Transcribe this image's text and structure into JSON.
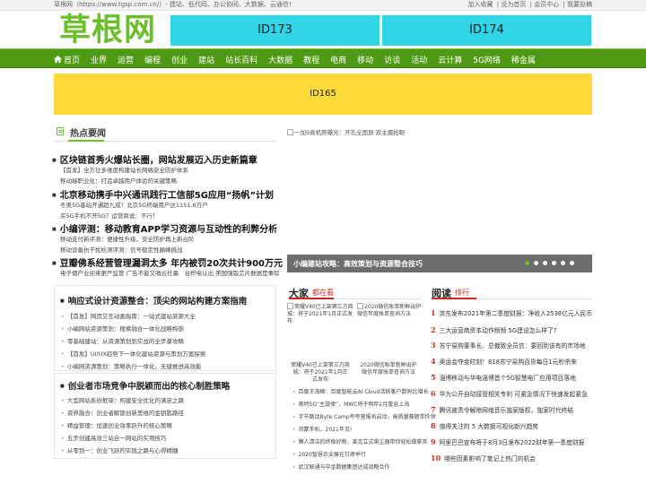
{
  "topbar": {
    "site_intro": "草根网（https://www.tgsp.com.cn/）- 建站、低代码、办公协同、大数据、云通信!",
    "links": [
      "加入收藏",
      "设为首页",
      "会员中心",
      "我要投稿"
    ],
    "separator": "|"
  },
  "logo": {
    "text": "草根网"
  },
  "ads": {
    "top_left": "ID173",
    "top_right": "ID174",
    "banner": "ID165"
  },
  "nav": {
    "home_icon": "home-icon",
    "items": [
      "首页",
      "业界",
      "运营",
      "编程",
      "创业",
      "建站",
      "站长百科",
      "大数据",
      "教程",
      "电商",
      "移动",
      "访谈",
      "活动",
      "云计算",
      "5G网络",
      "稀金属"
    ]
  },
  "hot": {
    "title": "热点要闻",
    "headlines": [
      {
        "title": "区块链首秀火爆站长圈，网站发展迈入历史新篇章",
        "subs": [
          "【首发】全方位多维度构建站长网络安全防护体系",
          "移动端职业化：打造卓越用户体验的关键策略"
        ]
      },
      {
        "title": "北京移动携手中兴通讯践行工信部5G应用“扬帆”计划",
        "subs": [
          "冬奥5G基站开通超九成！北京5G终端用户达1151.6万户",
          "买5G手机不开5G？运营商说：不行！"
        ]
      },
      {
        "title": "小编评测：移动教育APP学习资源与互动性的利弊分析",
        "subs": [
          "移动支付新评测：便捷性升级，安全防护再上新台阶",
          "移动设备抗干扰检测评测：信号稳定性巅峰挑战"
        ]
      },
      {
        "title": "豆瓣佛系经营管理漏洞太多 年内被罚20次共计900万元",
        "subs": [
          "电子烟产业迎来更严监管 广告不能又哨云社裏　台积电认出 美国强取芯片数据是事赊"
        ]
      }
    ]
  },
  "box1": {
    "title": "响应式设计资源整合：顶尖的网站构建方案指南",
    "items": [
      "【首发】网页交互动画指南：一站式建站资源大全",
      "小编网站资源策划：搜索融合一体化战略构想",
      "零基础建站：从资源策划到实战的全步骤攻略",
      "【首发】UI/UX趋势下一体化建站资源与策划方案探索",
      "小编网资源策划：策略执行一体化，无缝推进高效能"
    ]
  },
  "box2": {
    "title": "创业者市场竞争中脱颖而出的核心制胜策略",
    "items": [
      "大型网站系统框架：构建安全优化的满足之路",
      "资界融合：创业者解锁创新思维的金钥匙路径",
      "精益管理：加速创业效率跃升的核心策略",
      "五步创建高效三站合一网站的实用技巧",
      "从零到一：创业飞跃的实践之路与心得精髓"
    ]
  },
  "slider": {
    "img_alt": "一加9真机照曝光：开孔全面屏 双主摄抢眼",
    "caption": "小编建站攻略：高效策划与资源整合技巧",
    "dots": 6,
    "active_dot": 0
  },
  "recommend": {
    "label_cn": "大家",
    "label_em": "都在看",
    "thumbs": [
      {
        "alt": "荣耀V40已上架第三方商城：将于2021年1月正式发布",
        "caption": "荣耀V40已上架第三方商城：将于2021年1月正式发布"
      },
      {
        "alt": "2020微信账单新鲜出炉 微信年度账单查询方法",
        "caption": "2020微信账单新鲜出炉 微信年度账单查询方法"
      }
    ],
    "items": [
      "百度王海峰：百度智能云AI Cloud活跃客户数同比增长",
      "奥特5G“主旋律”，MWC将于明年2月重返上海",
      "字节跳动Byte Camp夸夸营报名启动，高质量赛题带你领",
      "鸿蒙手机，2021年见!",
      "懒人清洁的终极好物，莱克立式吸尘器带你轻松做家务",
      "2020智慧农业展在甘肃举行",
      "武汉联通与中金数据集团达成战略合作"
    ]
  },
  "ranking": {
    "label_cn": "阅读",
    "label_em": "排行",
    "items": [
      {
        "n": "1",
        "t": "京东发布2021年第二季度财报：净收入2538亿元人民币"
      },
      {
        "n": "2",
        "t": "三大运营商资本动作频频 5G建设怎么样了?"
      },
      {
        "n": "3",
        "t": "苏宁易购董事长、总裁致全员信：要回到该有的市场地"
      },
      {
        "n": "4",
        "t": "奥运会夺金时刻！818苏宁易购百货每日1元秒杀来"
      },
      {
        "n": "5",
        "t": "淄博移动与华电淄博首个5G智慧电厂应用项目落地"
      },
      {
        "n": "6",
        "t": "华为公开自动接管相关专利 可紧急情况下快速发起紧急"
      },
      {
        "n": "7",
        "t": "腾讯被责令解除网络音乐独家版权，独家时代终结"
      },
      {
        "n": "8",
        "t": "值得关注的 5 大数据可视化新兴趋势"
      },
      {
        "n": "9",
        "t": "阿里巴巴宣布将于8月3日发布2022财年第一季度财报"
      },
      {
        "n": "10",
        "t": "哪些因素影响了笔记上热门的机会"
      }
    ]
  },
  "colors": {
    "brand_green": "#6bbf2a",
    "nav_green": "#4f9a14",
    "ad_cyan": "#31d5e6",
    "ad_yellow": "#fdd93a",
    "accent_red": "#d3271e"
  }
}
